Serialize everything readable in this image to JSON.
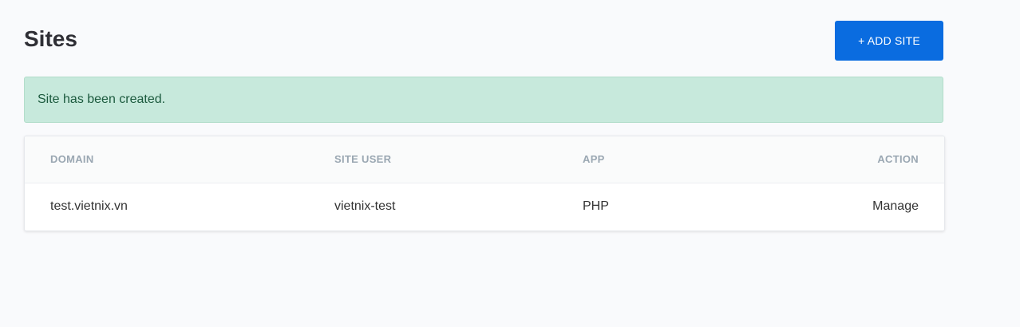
{
  "header": {
    "title": "Sites",
    "add_button_label": "+ ADD SITE"
  },
  "alert": {
    "message": "Site has been created.",
    "color": "#c7e9dc"
  },
  "table": {
    "columns": [
      "DOMAIN",
      "SITE USER",
      "APP",
      "ACTION"
    ],
    "rows": [
      {
        "domain": "test.vietnix.vn",
        "site_user": "vietnix-test",
        "app": "PHP",
        "action": "Manage"
      }
    ]
  },
  "colors": {
    "accent": "#0a6ce0",
    "background": "#f9fafc"
  }
}
